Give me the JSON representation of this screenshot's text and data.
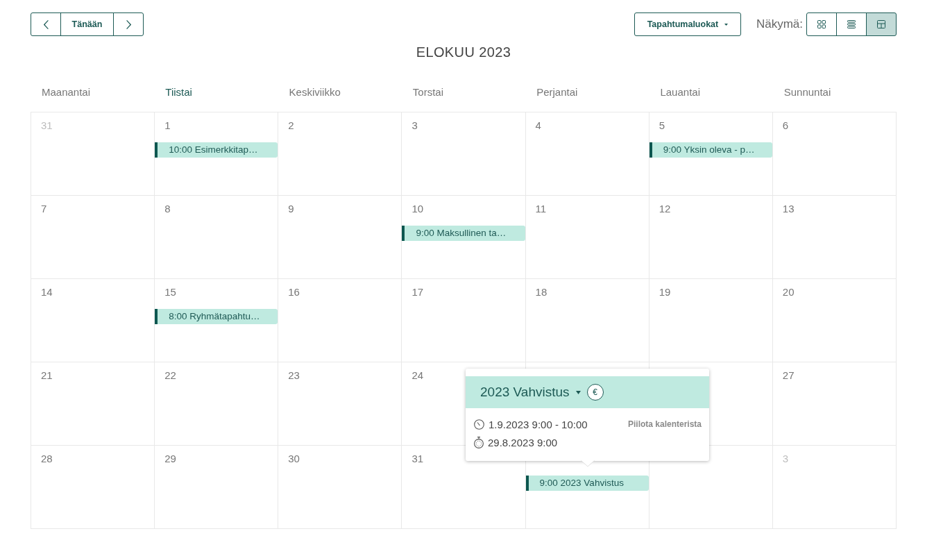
{
  "toolbar": {
    "today_button": "Tänään",
    "category_dropdown": "Tapahtumaluokat",
    "view_label": "Näkymä:",
    "view_buttons": [
      {
        "kind": "grid",
        "selected": false
      },
      {
        "kind": "list",
        "selected": false
      },
      {
        "kind": "month",
        "selected": true
      }
    ]
  },
  "calendar": {
    "title": "ELOKUU 2023",
    "weekdays": [
      {
        "label": "Maanantai",
        "current": false
      },
      {
        "label": "Tiistai",
        "current": true
      },
      {
        "label": "Keskiviikko",
        "current": false
      },
      {
        "label": "Torstai",
        "current": false
      },
      {
        "label": "Perjantai",
        "current": false
      },
      {
        "label": "Lauantai",
        "current": false
      },
      {
        "label": "Sunnuntai",
        "current": false
      }
    ],
    "weeks": [
      {
        "days": [
          {
            "kind": "date",
            "day": "31",
            "outside_month": true
          },
          {
            "kind": "date",
            "day": "1",
            "outside_month": false,
            "events": [
              {
                "label": "10:00 Esimerkkitap…"
              }
            ]
          },
          {
            "kind": "date",
            "day": "2",
            "outside_month": false
          },
          {
            "kind": "date",
            "day": "3",
            "outside_month": false
          },
          {
            "kind": "date",
            "day": "4",
            "outside_month": false
          },
          {
            "kind": "date",
            "day": "5",
            "outside_month": false,
            "events": [
              {
                "label": "9:00 Yksin oleva - p…"
              }
            ]
          },
          {
            "kind": "date",
            "day": "6",
            "outside_month": false
          }
        ]
      },
      {
        "days": [
          {
            "kind": "date",
            "day": "7",
            "outside_month": false
          },
          {
            "kind": "date",
            "day": "8",
            "outside_month": false
          },
          {
            "kind": "date",
            "day": "9",
            "outside_month": false
          },
          {
            "kind": "date",
            "day": "10",
            "outside_month": false,
            "events": [
              {
                "label": "9:00 Maksullinen ta…"
              }
            ]
          },
          {
            "kind": "date",
            "day": "11",
            "outside_month": false
          },
          {
            "kind": "date",
            "day": "12",
            "outside_month": false
          },
          {
            "kind": "date",
            "day": "13",
            "outside_month": false
          }
        ]
      },
      {
        "days": [
          {
            "kind": "date",
            "day": "14",
            "outside_month": false
          },
          {
            "kind": "date",
            "day": "15",
            "outside_month": false,
            "events": [
              {
                "label": "8:00 Ryhmätapahtu…"
              }
            ]
          },
          {
            "kind": "date",
            "day": "16",
            "outside_month": false
          },
          {
            "kind": "date",
            "day": "17",
            "outside_month": false
          },
          {
            "kind": "date",
            "day": "18",
            "outside_month": false
          },
          {
            "kind": "date",
            "day": "19",
            "outside_month": false
          },
          {
            "kind": "date",
            "day": "20",
            "outside_month": false
          }
        ]
      },
      {
        "days": [
          {
            "kind": "date",
            "day": "21",
            "outside_month": false
          },
          {
            "kind": "date",
            "day": "22",
            "outside_month": false
          },
          {
            "kind": "date",
            "day": "23",
            "outside_month": false
          },
          {
            "kind": "date",
            "day": "24",
            "outside_month": false
          },
          {
            "kind": "blank"
          },
          {
            "kind": "blank"
          },
          {
            "kind": "date",
            "day": "27",
            "outside_month": false
          }
        ]
      },
      {
        "days": [
          {
            "kind": "date",
            "day": "28",
            "outside_month": false
          },
          {
            "kind": "date",
            "day": "29",
            "outside_month": false
          },
          {
            "kind": "date",
            "day": "30",
            "outside_month": false
          },
          {
            "kind": "date",
            "day": "31",
            "outside_month": false
          },
          {
            "kind": "blank",
            "events": [
              {
                "label": "9:00 2023 Vahvistus"
              }
            ]
          },
          {
            "kind": "blank"
          },
          {
            "kind": "date",
            "day": "3",
            "outside_month": true
          }
        ]
      }
    ],
    "event_popup": {
      "title": "2023 Vahvistus",
      "price_badge": "€",
      "time": "1.9.2023 9:00 - 10:00",
      "hide_link": "Piilota kalenterista",
      "deadline": "29.8.2023 9:00"
    }
  }
}
